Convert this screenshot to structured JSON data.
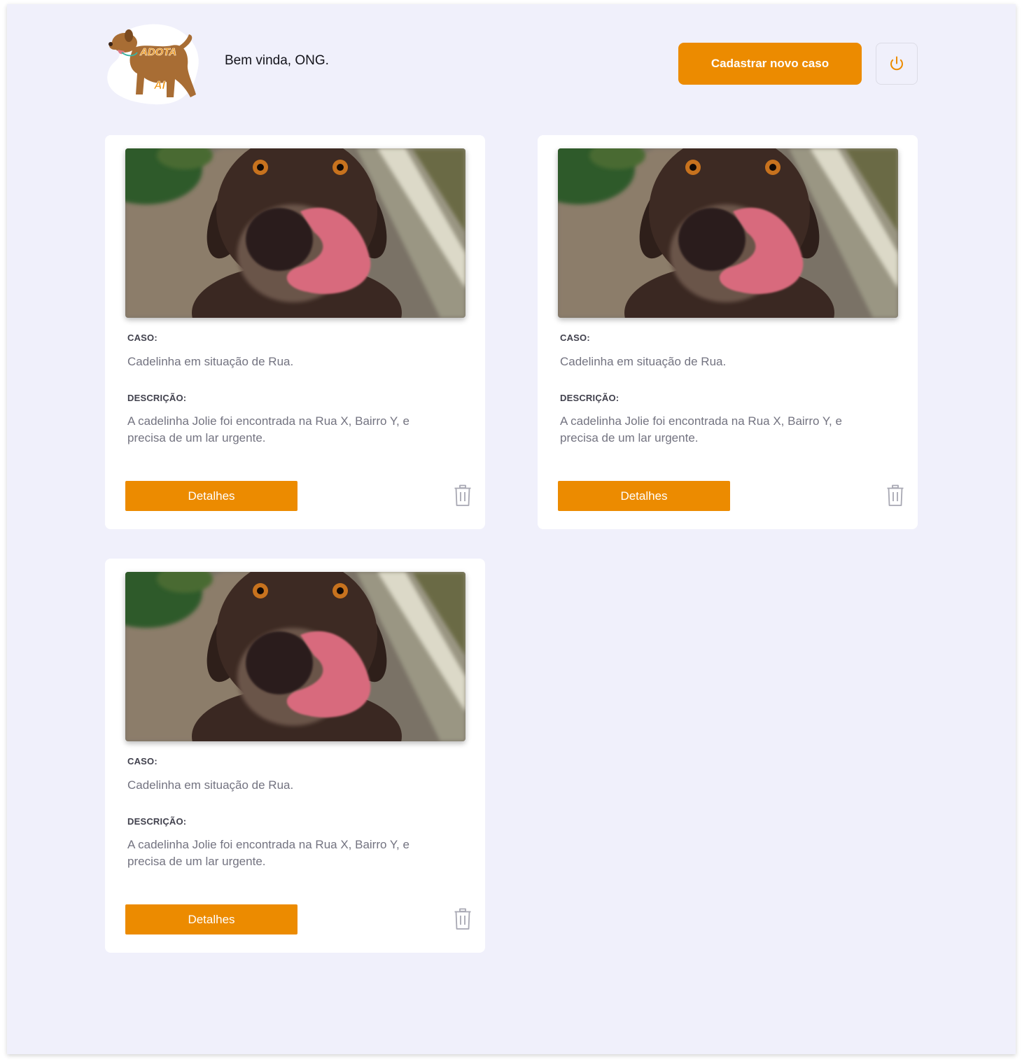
{
  "header": {
    "logo_text_top": "ADOTA",
    "logo_text_bottom": "AI",
    "welcome": "Bem vinda, ONG.",
    "new_case_label": "Cadastrar novo caso",
    "logout_icon": "power-icon"
  },
  "colors": {
    "accent": "#ec8b00",
    "background": "#f0f0fb",
    "card": "#ffffff",
    "label": "#41414d",
    "text": "#737380"
  },
  "cases": [
    {
      "case_label": "CASO:",
      "case_value": "Cadelinha em situação de Rua.",
      "desc_label": "DESCRIÇÃO:",
      "desc_value": "A cadelinha Jolie foi encontrada na Rua X, Bairro Y, e precisa de um lar urgente.",
      "details_label": "Detalhes",
      "delete_icon": "trash-icon"
    },
    {
      "case_label": "CASO:",
      "case_value": "Cadelinha em situação de Rua.",
      "desc_label": "DESCRIÇÃO:",
      "desc_value": "A cadelinha Jolie foi encontrada na Rua X, Bairro Y, e precisa de um lar urgente.",
      "details_label": "Detalhes",
      "delete_icon": "trash-icon"
    },
    {
      "case_label": "CASO:",
      "case_value": "Cadelinha em situação de Rua.",
      "desc_label": "DESCRIÇÃO:",
      "desc_value": "A cadelinha Jolie foi encontrada na Rua X, Bairro Y, e precisa de um lar urgente.",
      "details_label": "Detalhes",
      "delete_icon": "trash-icon"
    }
  ]
}
